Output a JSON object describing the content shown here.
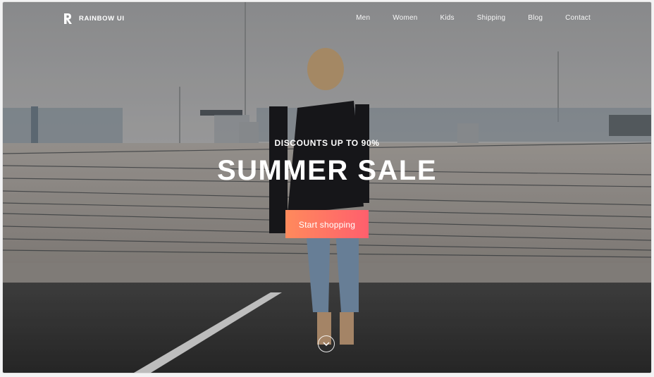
{
  "brand": {
    "name": "RAINBOW UI",
    "logo_icon": "rainbow-ui-logo-icon"
  },
  "nav": {
    "items": [
      {
        "label": "Men"
      },
      {
        "label": "Women"
      },
      {
        "label": "Kids"
      },
      {
        "label": "Shipping"
      },
      {
        "label": "Blog"
      },
      {
        "label": "Contact"
      }
    ]
  },
  "hero": {
    "eyebrow": "DISCOUNTS UP TO 90%",
    "title": "SUMMER SALE",
    "cta_label": "Start shopping",
    "cta_gradient": [
      "#ff8a5c",
      "#ff5f6d"
    ],
    "scroll_icon": "chevron-down-icon"
  },
  "colors": {
    "sky": "#a8a9ab",
    "ground": "#3a3a3a",
    "text": "#ffffff"
  }
}
